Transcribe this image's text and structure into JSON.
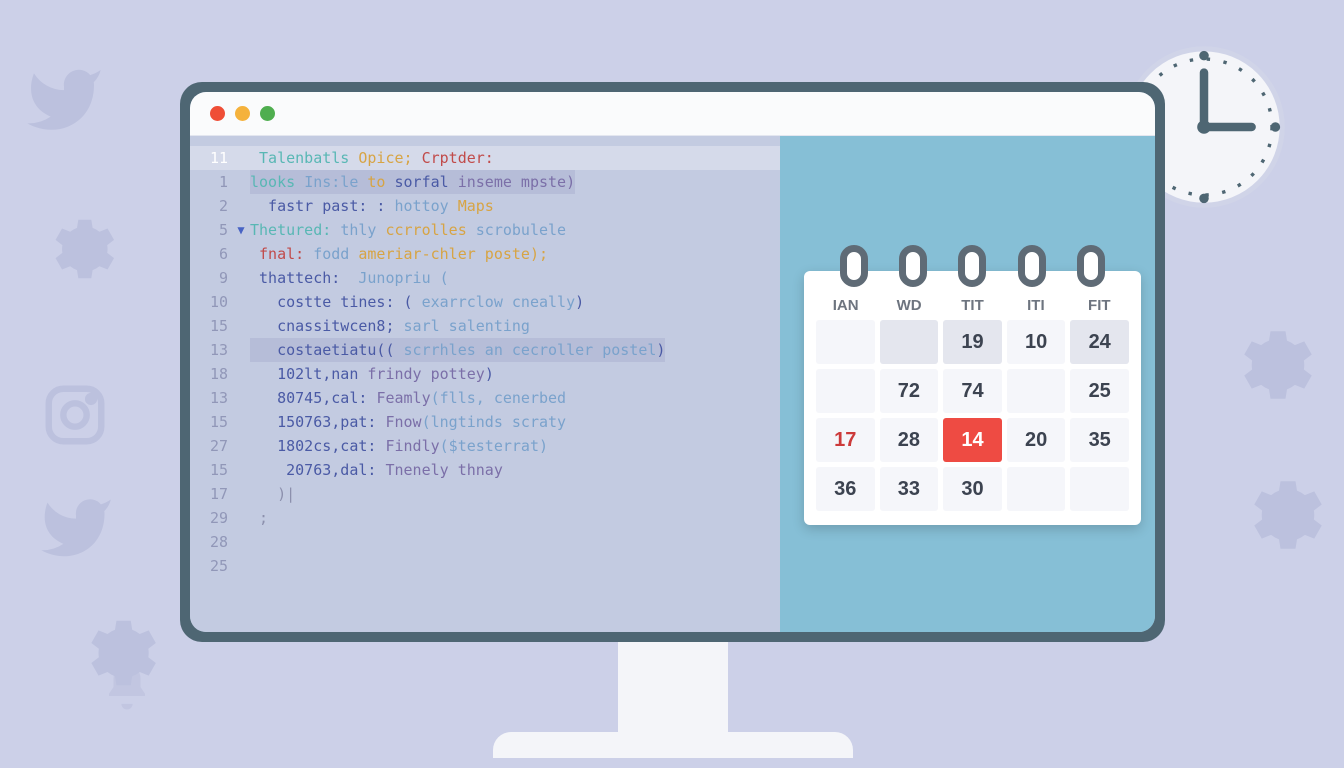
{
  "code": {
    "lines": [
      {
        "num": "11",
        "active": true,
        "segments": [
          {
            "t": " ",
            "c": ""
          },
          {
            "t": "Talenbatls",
            "c": "tk-teal"
          },
          {
            "t": " ",
            "c": ""
          },
          {
            "t": "Opice;",
            "c": "tk-yellow"
          },
          {
            "t": " ",
            "c": ""
          },
          {
            "t": "Crptder:",
            "c": "tk-red"
          }
        ]
      },
      {
        "num": "1",
        "hl": true,
        "segments": [
          {
            "t": "looks",
            "c": "tk-teal"
          },
          {
            "t": " ",
            "c": ""
          },
          {
            "t": "Ins:le",
            "c": "tk-lightblue"
          },
          {
            "t": " ",
            "c": ""
          },
          {
            "t": "to",
            "c": "tk-yellow"
          },
          {
            "t": " ",
            "c": ""
          },
          {
            "t": "sorfal",
            "c": "tk-blue"
          },
          {
            "t": " ",
            "c": ""
          },
          {
            "t": "inseme mpste)",
            "c": "tk-purple"
          }
        ]
      },
      {
        "num": "2",
        "segments": [
          {
            "t": "  fastr past: : ",
            "c": "tk-blue"
          },
          {
            "t": "hottoy",
            "c": "tk-lightblue"
          },
          {
            "t": " ",
            "c": ""
          },
          {
            "t": "Maps",
            "c": "tk-yellow"
          }
        ]
      },
      {
        "num": "5",
        "arrow": true,
        "segments": [
          {
            "t": "Thetured:",
            "c": "tk-teal"
          },
          {
            "t": " ",
            "c": ""
          },
          {
            "t": "thly",
            "c": "tk-lightblue"
          },
          {
            "t": " ",
            "c": ""
          },
          {
            "t": "ccrrolles",
            "c": "tk-yellow"
          },
          {
            "t": " ",
            "c": ""
          },
          {
            "t": "scrobulele",
            "c": "tk-lightblue"
          }
        ]
      },
      {
        "num": "6",
        "segments": [
          {
            "t": " ",
            "c": ""
          },
          {
            "t": "fnal:",
            "c": "tk-red"
          },
          {
            "t": " ",
            "c": ""
          },
          {
            "t": "fodd",
            "c": "tk-lightblue"
          },
          {
            "t": " ",
            "c": ""
          },
          {
            "t": "ameriar-chler poste);",
            "c": "tk-yellow"
          }
        ]
      },
      {
        "num": "9",
        "segments": [
          {
            "t": " thattech:  ",
            "c": "tk-blue"
          },
          {
            "t": "Junopriu (",
            "c": "tk-lightblue"
          }
        ]
      },
      {
        "num": "10",
        "segments": [
          {
            "t": "   costte tines: ( ",
            "c": "tk-blue"
          },
          {
            "t": "exarrclow cneally",
            "c": "tk-lightblue"
          },
          {
            "t": ")",
            "c": "tk-blue"
          }
        ]
      },
      {
        "num": "15",
        "segments": [
          {
            "t": "   cnassitwcen8; ",
            "c": "tk-blue"
          },
          {
            "t": "sarl salenting",
            "c": "tk-lightblue"
          }
        ]
      },
      {
        "num": "13",
        "hl": true,
        "segments": [
          {
            "t": "   costaetiatu(( ",
            "c": "tk-blue"
          },
          {
            "t": "scrrhles an cecroller postel",
            "c": "tk-lightblue"
          },
          {
            "t": ")",
            "c": "tk-blue"
          }
        ]
      },
      {
        "num": "18",
        "segments": [
          {
            "t": "   102lt,nan ",
            "c": "tk-blue"
          },
          {
            "t": "frindy pottey",
            "c": "tk-purple"
          },
          {
            "t": ")",
            "c": "tk-blue"
          }
        ]
      },
      {
        "num": "13",
        "segments": [
          {
            "t": "   80745,cal: ",
            "c": "tk-blue"
          },
          {
            "t": "Feamly",
            "c": "tk-purple"
          },
          {
            "t": "(flls, cenerbed",
            "c": "tk-lightblue"
          }
        ]
      },
      {
        "num": "15",
        "segments": [
          {
            "t": "   150763,pat: ",
            "c": "tk-blue"
          },
          {
            "t": "Fnow",
            "c": "tk-purple"
          },
          {
            "t": "(lngtinds scraty",
            "c": "tk-lightblue"
          }
        ]
      },
      {
        "num": "27",
        "segments": [
          {
            "t": "   1802cs,cat: ",
            "c": "tk-blue"
          },
          {
            "t": "Findly",
            "c": "tk-purple"
          },
          {
            "t": "($testerrat)",
            "c": "tk-lightblue"
          }
        ]
      },
      {
        "num": "15",
        "segments": [
          {
            "t": "    20763,dal: ",
            "c": "tk-blue"
          },
          {
            "t": "Tnenely thnay",
            "c": "tk-purple"
          }
        ]
      },
      {
        "num": "17",
        "segments": [
          {
            "t": "   )|",
            "c": "tk-grey"
          }
        ]
      },
      {
        "num": "29",
        "segments": [
          {
            "t": " ;",
            "c": "tk-grey"
          }
        ]
      },
      {
        "num": "28",
        "segments": []
      },
      {
        "num": "25",
        "segments": []
      }
    ]
  },
  "calendar": {
    "headers": [
      "IAN",
      "WD",
      "TIT",
      "ITI",
      "FIT"
    ],
    "rows": [
      [
        {
          "v": "",
          "c": "empty"
        },
        {
          "v": "",
          "c": "dim"
        },
        {
          "v": "19",
          "c": "dim"
        },
        {
          "v": "10",
          "c": ""
        },
        {
          "v": "24",
          "c": "dim"
        }
      ],
      [
        {
          "v": "",
          "c": "empty"
        },
        {
          "v": "72",
          "c": ""
        },
        {
          "v": "74",
          "c": ""
        },
        {
          "v": "",
          "c": "empty"
        },
        {
          "v": "25",
          "c": ""
        }
      ],
      [
        {
          "v": "17",
          "c": "red-text"
        },
        {
          "v": "28",
          "c": ""
        },
        {
          "v": "14",
          "c": "active"
        },
        {
          "v": "20",
          "c": ""
        },
        {
          "v": "35",
          "c": ""
        }
      ],
      [
        {
          "v": "36",
          "c": ""
        },
        {
          "v": "33",
          "c": ""
        },
        {
          "v": "30",
          "c": ""
        },
        {
          "v": "",
          "c": "empty"
        },
        {
          "v": "",
          "c": "empty"
        }
      ]
    ]
  }
}
